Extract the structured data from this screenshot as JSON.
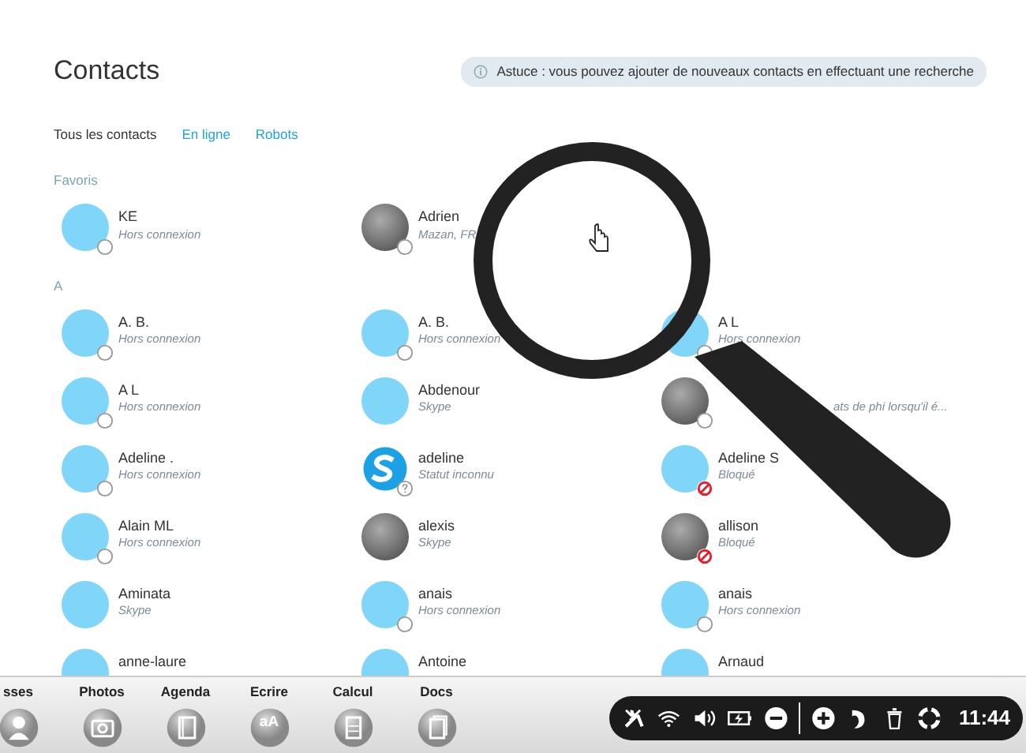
{
  "title": "Contacts",
  "tip": "Astuce : vous pouvez ajouter de nouveaux contacts en effectuant une recherche",
  "tabs": [
    {
      "label": "Tous les contacts",
      "selected": true
    },
    {
      "label": "En ligne",
      "selected": false
    },
    {
      "label": "Robots",
      "selected": false
    }
  ],
  "groups": [
    {
      "heading": "Favoris",
      "contacts": [
        {
          "name": "KE",
          "status_text": "Hors connexion",
          "photo": false,
          "kind": "offline"
        },
        {
          "name": "Adrien",
          "status_text": "Mazan, FR",
          "photo": true,
          "kind": "offline"
        }
      ]
    },
    {
      "heading": "A",
      "contacts": [
        {
          "name": "A. B.",
          "status_text": "Hors connexion",
          "photo": false,
          "kind": "offline"
        },
        {
          "name": "A. B.",
          "status_text": "Hors connexion",
          "photo": false,
          "kind": "offline"
        },
        {
          "name": "A L",
          "status_text": "Hors connexion",
          "photo": false,
          "kind": "offline"
        },
        {
          "name": "A L",
          "status_text": "Hors connexion",
          "photo": false,
          "kind": "offline"
        },
        {
          "name": "Abdenour",
          "status_text": "Skype",
          "photo": false,
          "kind": "plain"
        },
        {
          "status_text": "ats de phi lorsqu'il é...",
          "photo": true,
          "kind": "offline"
        },
        {
          "name": "Adeline .",
          "status_text": "Hors connexion",
          "photo": false,
          "kind": "offline"
        },
        {
          "name": "adeline",
          "status_text": "Statut inconnu",
          "photo": false,
          "logo": true,
          "kind": "unknown"
        },
        {
          "name": "Adeline S",
          "status_text": "Bloqué",
          "photo": false,
          "kind": "blocked"
        },
        {
          "name": "Alain ML",
          "status_text": "Hors connexion",
          "photo": false,
          "kind": "offline"
        },
        {
          "name": "alexis",
          "status_text": "Skype",
          "photo": true,
          "kind": "plain"
        },
        {
          "name": "allison",
          "status_text": "Bloqué",
          "photo": true,
          "kind": "blocked"
        },
        {
          "name": "Aminata",
          "status_text": "Skype",
          "photo": false,
          "kind": "plain"
        },
        {
          "name": "anais",
          "status_text": "Hors connexion",
          "photo": false,
          "kind": "offline"
        },
        {
          "name": "anais",
          "status_text": "Hors connexion",
          "photo": false,
          "kind": "offline"
        },
        {
          "name": "anne-laure",
          "photo": false,
          "kind": "plain"
        },
        {
          "name": "Antoine",
          "photo": false,
          "kind": "plain"
        },
        {
          "name": "Arnaud",
          "photo": false,
          "kind": "plain"
        }
      ]
    }
  ],
  "dock": [
    {
      "label": "sses"
    },
    {
      "label": "Photos"
    },
    {
      "label": "Agenda"
    },
    {
      "label": "Ecrire",
      "icon_text": "aA"
    },
    {
      "label": "Calcul"
    },
    {
      "label": "Docs"
    }
  ],
  "tray": {
    "time": "11:44"
  }
}
